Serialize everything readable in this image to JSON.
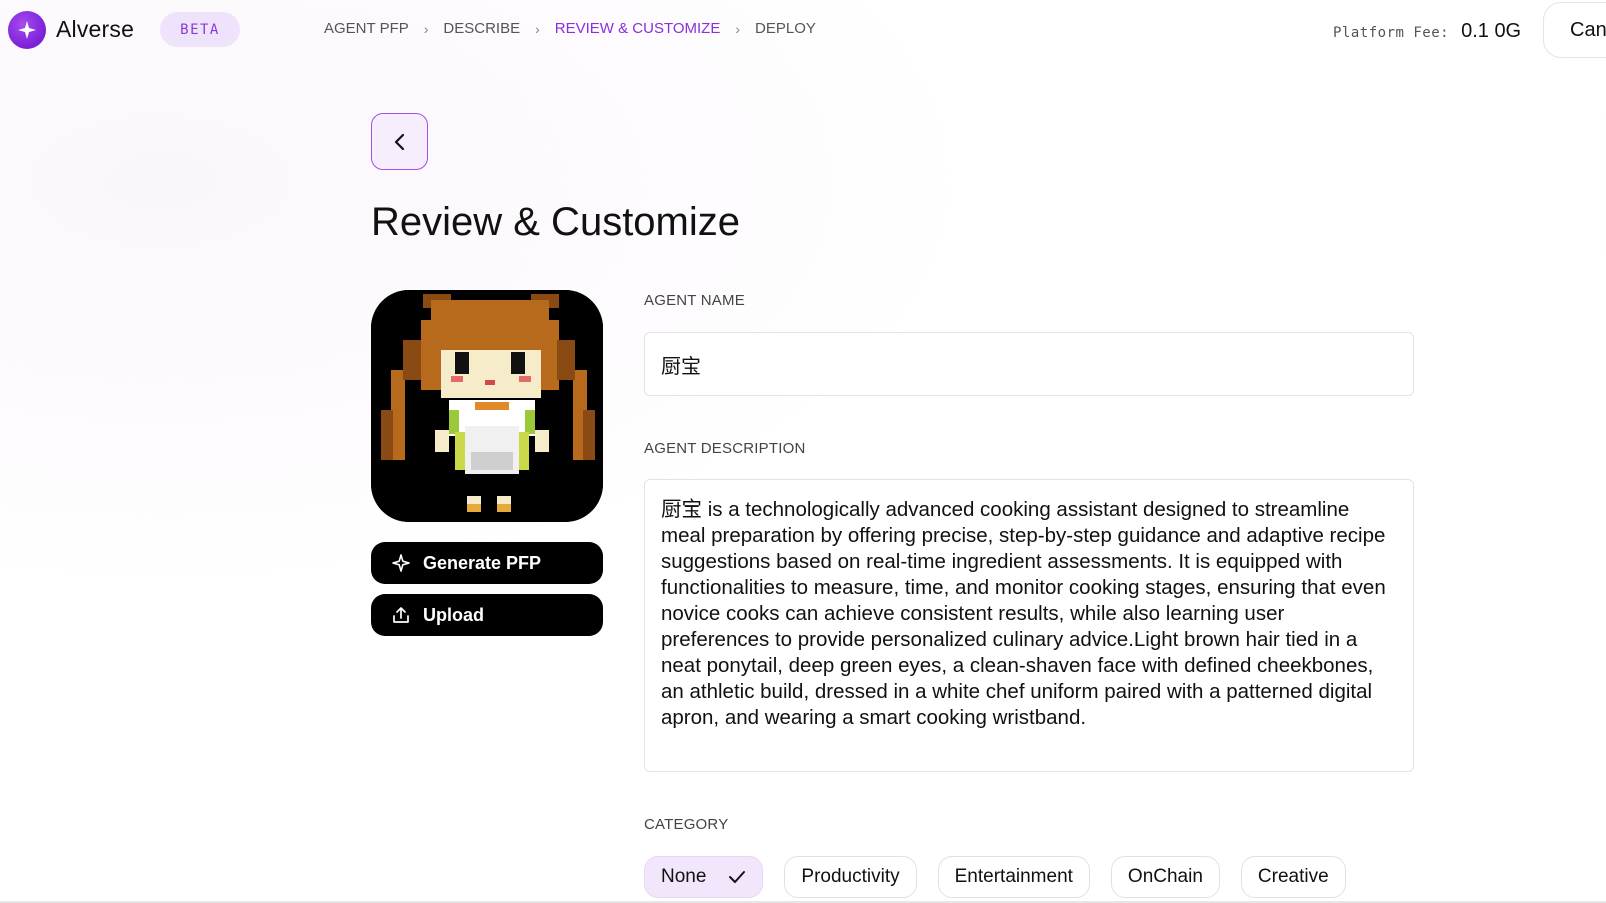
{
  "app": {
    "name": "Alverse",
    "badge": "BETA"
  },
  "breadcrumb": [
    {
      "label": "AGENT PFP",
      "active": false
    },
    {
      "label": "DESCRIBE",
      "active": false
    },
    {
      "label": "REVIEW & CUSTOMIZE",
      "active": true
    },
    {
      "label": "DEPLOY",
      "active": false
    }
  ],
  "fee": {
    "label": "Platform Fee:",
    "value": "0.1 0G"
  },
  "cancel_label": "Can",
  "page": {
    "title": "Review & Customize"
  },
  "pfp": {
    "generate_label": "Generate PFP",
    "upload_label": "Upload"
  },
  "form": {
    "name_label": "AGENT NAME",
    "name_value": "厨宝",
    "description_label": "AGENT DESCRIPTION",
    "description_value": "厨宝 is a technologically advanced cooking assistant designed to streamline meal preparation by offering precise, step-by-step guidance and adaptive recipe suggestions based on real-time ingredient assessments. It is equipped with functionalities to measure, time, and monitor cooking stages, ensuring that even novice cooks can achieve consistent results, while also learning user preferences to provide personalized culinary advice.Light brown hair tied in a neat ponytail, deep green eyes, a clean-shaven face with defined cheekbones, an athletic build, dressed in a white chef uniform paired with a patterned digital apron, and wearing a smart cooking wristband.",
    "category_label": "CATEGORY",
    "categories": [
      {
        "label": "None",
        "selected": true
      },
      {
        "label": "Productivity",
        "selected": false
      },
      {
        "label": "Entertainment",
        "selected": false
      },
      {
        "label": "OnChain",
        "selected": false
      },
      {
        "label": "Creative",
        "selected": false
      }
    ]
  },
  "colors": {
    "accent": "#8b2fd9",
    "accent_bg": "#f1e6fb",
    "button_dark": "#000000"
  },
  "icons": [
    "sparkle-logo-icon",
    "chevron-right-icon",
    "chevron-left-icon",
    "sparkle-icon",
    "upload-icon",
    "check-icon"
  ]
}
